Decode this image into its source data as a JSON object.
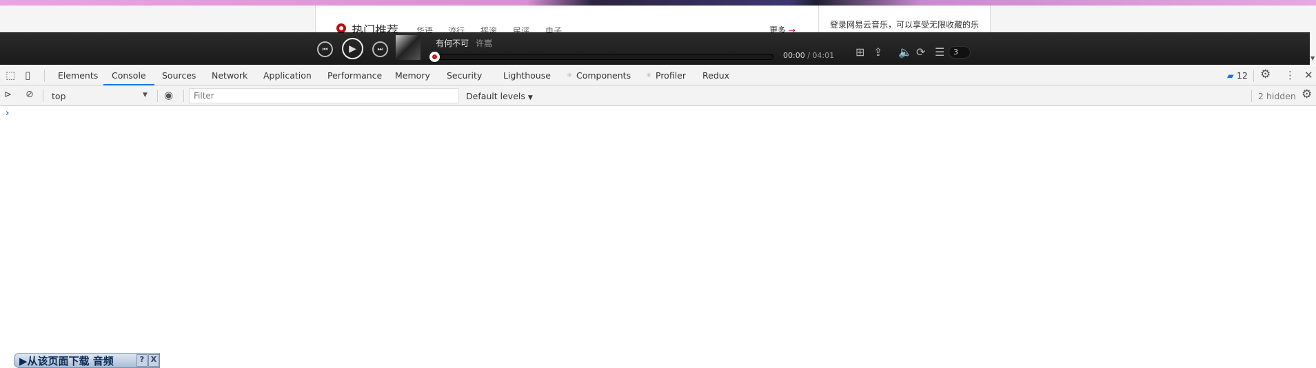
{
  "page": {
    "section_title": "热门推荐",
    "categories": [
      "华语",
      "流行",
      "摇滚",
      "民谣",
      "电子"
    ],
    "more": "更多",
    "login_text": "登录网易云音乐，可以享受无限收藏的乐趣，并且无限同步到手机"
  },
  "player": {
    "song": "有何不可",
    "artist": "许嵩",
    "current_time": "00:00",
    "total_time": "/ 04:01",
    "progress_percent": 0,
    "playlist_count": "3",
    "accent": "#c20c0c"
  },
  "devtools": {
    "tabs": [
      "Elements",
      "Console",
      "Sources",
      "Network",
      "Application",
      "Performance",
      "Memory",
      "Security",
      "Lighthouse",
      "Components",
      "Profiler",
      "Redux"
    ],
    "active_tab": "Console",
    "message_count": "12",
    "toolbar": {
      "context": "top",
      "filter_placeholder": "Filter",
      "levels": "Default levels",
      "hidden": "2 hidden"
    },
    "prompt": "›"
  },
  "download_bar": {
    "label": "▶从该页面下载 音频",
    "help": "?",
    "close": "X"
  }
}
